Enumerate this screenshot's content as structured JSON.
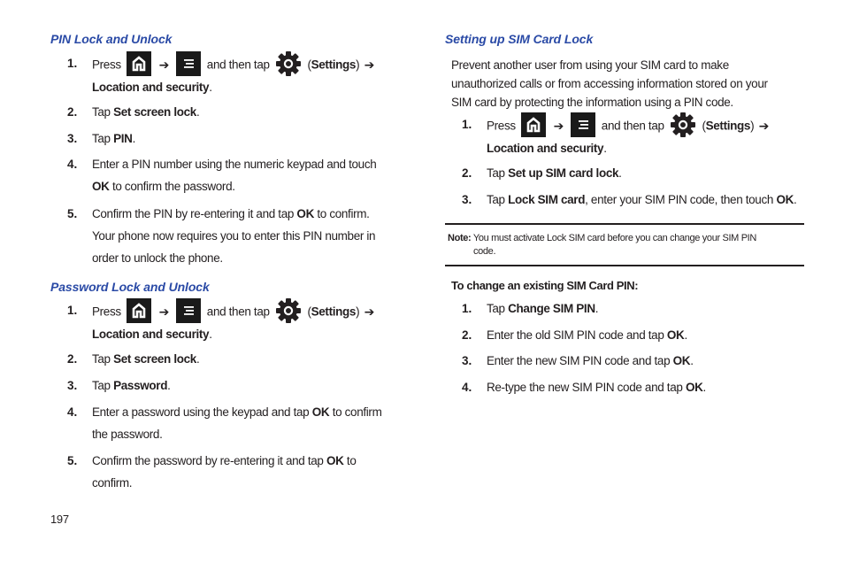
{
  "page_number": "197",
  "colors": {
    "heading": "#2a4aa6",
    "text": "#231f20",
    "icon_bg": "#1a1a1a"
  },
  "icons": {
    "home": "home-key-icon",
    "menu": "menu-key-icon",
    "settings": "settings-gear-icon",
    "arrow": "➔"
  },
  "common": {
    "press": "Press",
    "and_then_tap": "and then tap",
    "settings_open": "(",
    "settings_label": "Settings",
    "settings_close": ")",
    "arrow": "➔",
    "location_security": "Location and security",
    "period": "."
  },
  "left": {
    "pin_section": {
      "title": "PIN Lock and Unlock",
      "steps": [
        {
          "num": "1."
        },
        {
          "num": "2.",
          "pre": "Tap ",
          "bold": "Set screen lock",
          "post": "."
        },
        {
          "num": "3.",
          "pre": "Tap ",
          "bold": "PIN",
          "post": "."
        },
        {
          "num": "4.",
          "line1": "Enter a PIN number using the numeric keypad and touch",
          "bold": "OK",
          "post": " to confirm the password."
        },
        {
          "num": "5.",
          "pre": "Confirm the PIN by re-entering it and tap ",
          "bold": "OK",
          "post": " to confirm.",
          "line2": "Your phone now requires you to enter this PIN number in",
          "line3": "order to unlock the phone."
        }
      ]
    },
    "password_section": {
      "title": "Password Lock and Unlock",
      "steps": [
        {
          "num": "1."
        },
        {
          "num": "2.",
          "pre": "Tap ",
          "bold": "Set screen lock",
          "post": "."
        },
        {
          "num": "3.",
          "pre": "Tap ",
          "bold": "Password",
          "post": "."
        },
        {
          "num": "4.",
          "pre": "Enter a password using the keypad and tap ",
          "bold": "OK",
          "post": " to confirm",
          "line2": "the password."
        },
        {
          "num": "5.",
          "pre": "Confirm the password by re-entering it and tap ",
          "bold": "OK",
          "post": " to",
          "line2": "confirm."
        }
      ]
    }
  },
  "right": {
    "sim_section": {
      "title": "Setting up SIM Card Lock",
      "intro": [
        "Prevent another user from using your SIM card to make",
        "unauthorized calls or from accessing information stored on your",
        "SIM card by protecting the information using a PIN code."
      ],
      "steps": [
        {
          "num": "1."
        },
        {
          "num": "2.",
          "pre": "Tap ",
          "bold": "Set up SIM card lock",
          "post": "."
        },
        {
          "num": "3.",
          "pre": "Tap ",
          "bold": "Lock SIM card",
          "mid": ", enter your SIM PIN code, then touch ",
          "bold2": "OK",
          "post": "."
        }
      ],
      "note": {
        "label": "Note:",
        "text": " You must activate Lock SIM card before you can change your SIM PIN",
        "line2": "code."
      }
    },
    "change_pin": {
      "title": "To change an existing SIM Card PIN:",
      "steps": [
        {
          "num": "1.",
          "pre": "Tap ",
          "bold": "Change SIM PIN",
          "post": "."
        },
        {
          "num": "2.",
          "pre": "Enter the old SIM PIN code and tap ",
          "bold": "OK",
          "post": "."
        },
        {
          "num": "3.",
          "pre": "Enter the new SIM PIN code and tap ",
          "bold": "OK",
          "post": "."
        },
        {
          "num": "4.",
          "pre": "Re-type the new SIM PIN code and tap ",
          "bold": "OK",
          "post": "."
        }
      ]
    }
  }
}
